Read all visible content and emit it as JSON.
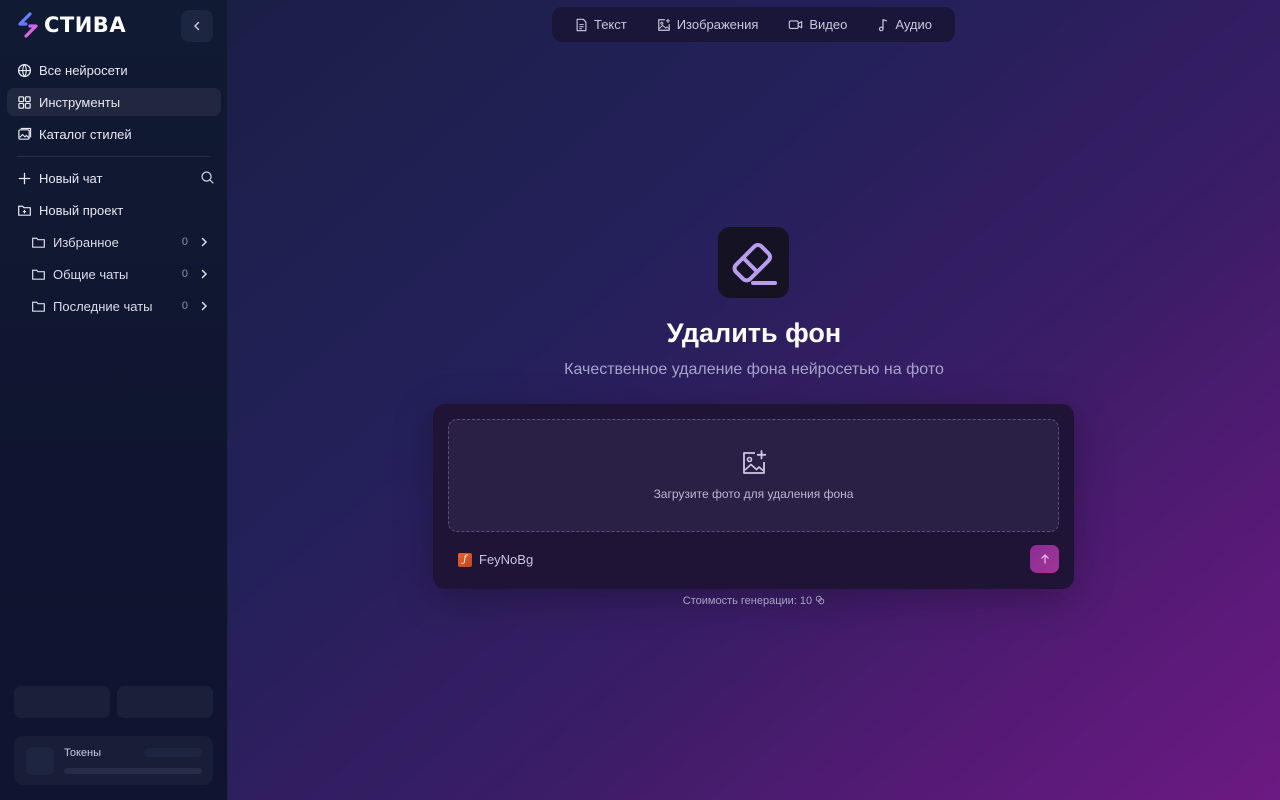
{
  "app": {
    "logo_text": "СТИВА"
  },
  "sidebar": {
    "nav": [
      {
        "label": "Все нейросети",
        "icon": "globe-icon"
      },
      {
        "label": "Инструменты",
        "icon": "grid-icon",
        "active": true
      },
      {
        "label": "Каталог стилей",
        "icon": "gallery-icon"
      }
    ],
    "new_chat": "Новый чат",
    "new_project": "Новый проект",
    "folders": [
      {
        "label": "Избранное",
        "count": "0"
      },
      {
        "label": "Общие чаты",
        "count": "0"
      },
      {
        "label": "Последние чаты",
        "count": "0"
      }
    ],
    "tokens_label": "Токены"
  },
  "top_tabs": [
    {
      "label": "Текст",
      "icon": "document-icon"
    },
    {
      "label": "Изображения",
      "icon": "image-plus-icon"
    },
    {
      "label": "Видео",
      "icon": "video-icon"
    },
    {
      "label": "Аудио",
      "icon": "music-note-icon"
    }
  ],
  "tool": {
    "icon": "eraser-icon",
    "title": "Удалить фон",
    "subtitle": "Качественное удаление фона нейросетью на фото",
    "upload_text": "Загрузите фото для удаления фона",
    "model": "FeyNoBg",
    "cost_text": "Стоимость генерации: 10"
  },
  "colors": {
    "accent": "#a13596",
    "icon_purple": "#b79cf0"
  }
}
